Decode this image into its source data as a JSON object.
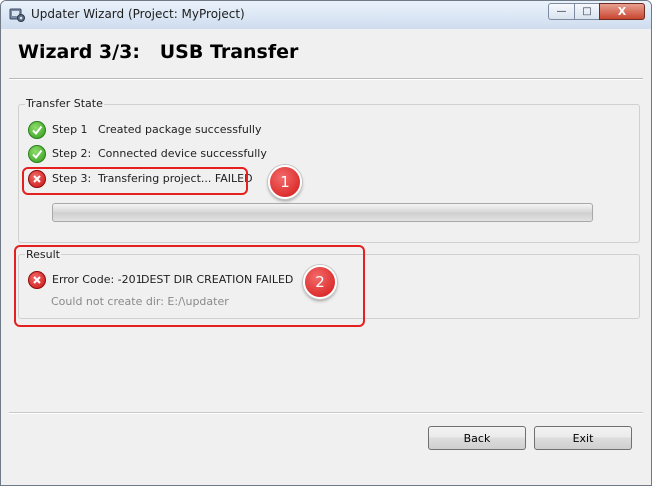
{
  "window": {
    "title": "Updater Wizard (Project: MyProject)"
  },
  "header": {
    "title": "Wizard 3/3:   USB Transfer"
  },
  "transfer_state": {
    "title": "Transfer State",
    "steps": [
      {
        "step": "Step 1",
        "text": "Created package successfully",
        "status": "ok"
      },
      {
        "step": "Step 2:",
        "text": "Connected device successfully",
        "status": "ok"
      },
      {
        "step": "Step 3:",
        "text": "Transfering project... FAILED",
        "status": "error"
      }
    ],
    "progress": 0
  },
  "result": {
    "title": "Result",
    "error_label": "Error Code: -201",
    "error_text": "DEST DIR CREATION FAILED",
    "detail": "Could not create dir: E:/\\updater"
  },
  "callouts": [
    "1",
    "2"
  ],
  "buttons": {
    "back": "Back",
    "exit": "Exit"
  },
  "window_buttons": {
    "minimize": "—",
    "maximize": "□",
    "close": "X"
  },
  "colors": {
    "error": "#c81212",
    "ok": "#2f9b1c",
    "callout": "#e42020"
  }
}
